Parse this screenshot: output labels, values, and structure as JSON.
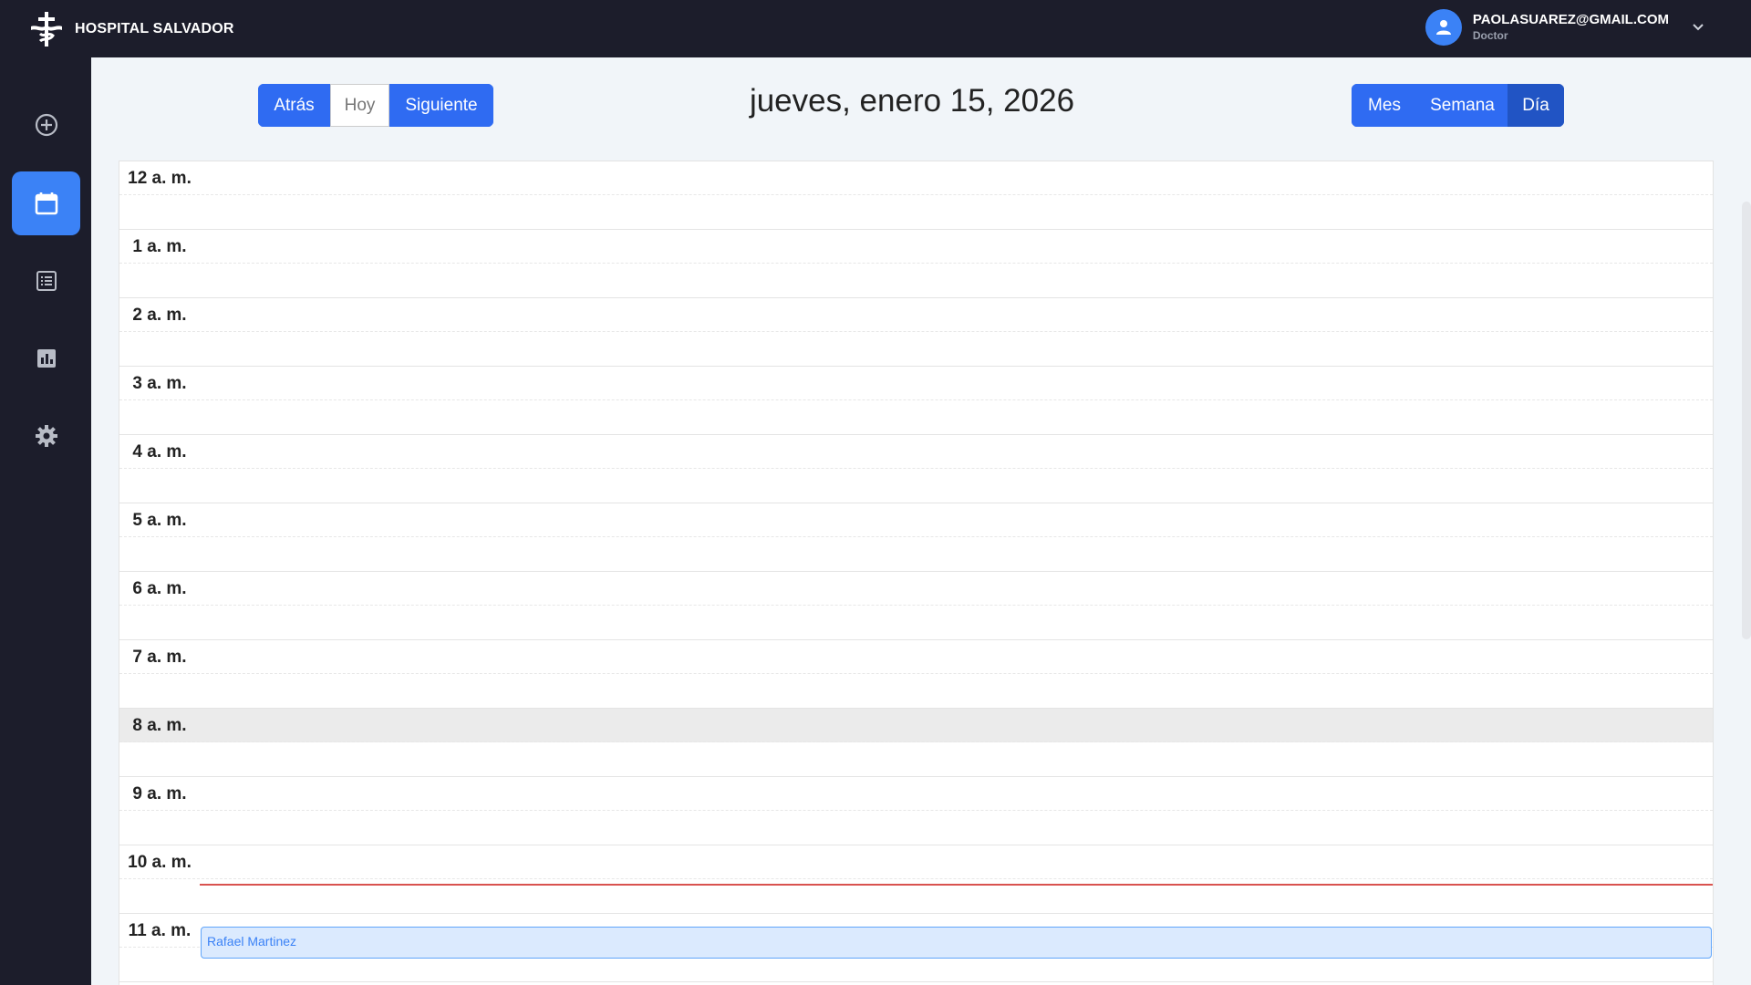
{
  "header": {
    "brand": "HOSPITAL SALVADOR",
    "user_email": "PAOLASUAREZ@GMAIL.COM",
    "user_role": "Doctor"
  },
  "sidebar": {
    "items": [
      {
        "icon": "plus-circle-icon"
      },
      {
        "icon": "calendar-icon",
        "active": true
      },
      {
        "icon": "list-icon"
      },
      {
        "icon": "chart-icon"
      },
      {
        "icon": "gear-icon"
      }
    ]
  },
  "toolbar": {
    "back_label": "Atrás",
    "today_label": "Hoy",
    "next_label": "Siguiente",
    "month_label": "Mes",
    "week_label": "Semana",
    "day_label": "Día",
    "active_view": "Día"
  },
  "title": "jueves, enero 15, 2026",
  "calendar": {
    "hours": [
      "12 a. m.",
      "1 a. m.",
      "2 a. m.",
      "3 a. m.",
      "4 a. m.",
      "5 a. m.",
      "6 a. m.",
      "7 a. m.",
      "8 a. m.",
      "9 a. m.",
      "10 a. m.",
      "11 a. m."
    ],
    "highlighted_hour": "8 a. m.",
    "event": {
      "title": "Rafael Martinez"
    }
  },
  "colors": {
    "header_bg": "#1c1d2b",
    "accent": "#3b82f6",
    "now_line": "#d9534f",
    "event_bg": "#dbeafe"
  }
}
